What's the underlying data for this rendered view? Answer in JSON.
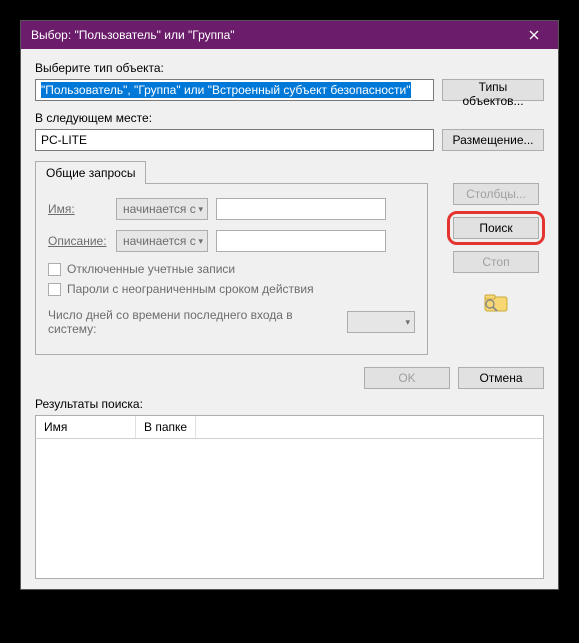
{
  "titlebar": {
    "text": "Выбор: \"Пользователь\" или \"Группа\""
  },
  "objectType": {
    "label": "Выберите тип объекта:",
    "value": "\"Пользователь\", \"Группа\" или \"Встроенный субъект безопасности\"",
    "button": "Типы объектов..."
  },
  "location": {
    "label": "В следующем месте:",
    "value": "PC-LITE",
    "button": "Размещение..."
  },
  "tab": {
    "label": "Общие запросы"
  },
  "form": {
    "nameLabel": "Имя:",
    "descLabel": "Описание:",
    "startsWith": "начинается с",
    "disabledAccounts": "Отключенные учетные записи",
    "nonExpiringPasswords": "Пароли с неограниченным сроком действия",
    "daysLabel": "Число дней со времени последнего входа в систему:"
  },
  "side": {
    "columns": "Столбцы...",
    "search": "Поиск",
    "stop": "Стоп"
  },
  "bottom": {
    "ok": "OK",
    "cancel": "Отмена"
  },
  "results": {
    "label": "Результаты поиска:",
    "colName": "Имя",
    "colFolder": "В папке"
  }
}
